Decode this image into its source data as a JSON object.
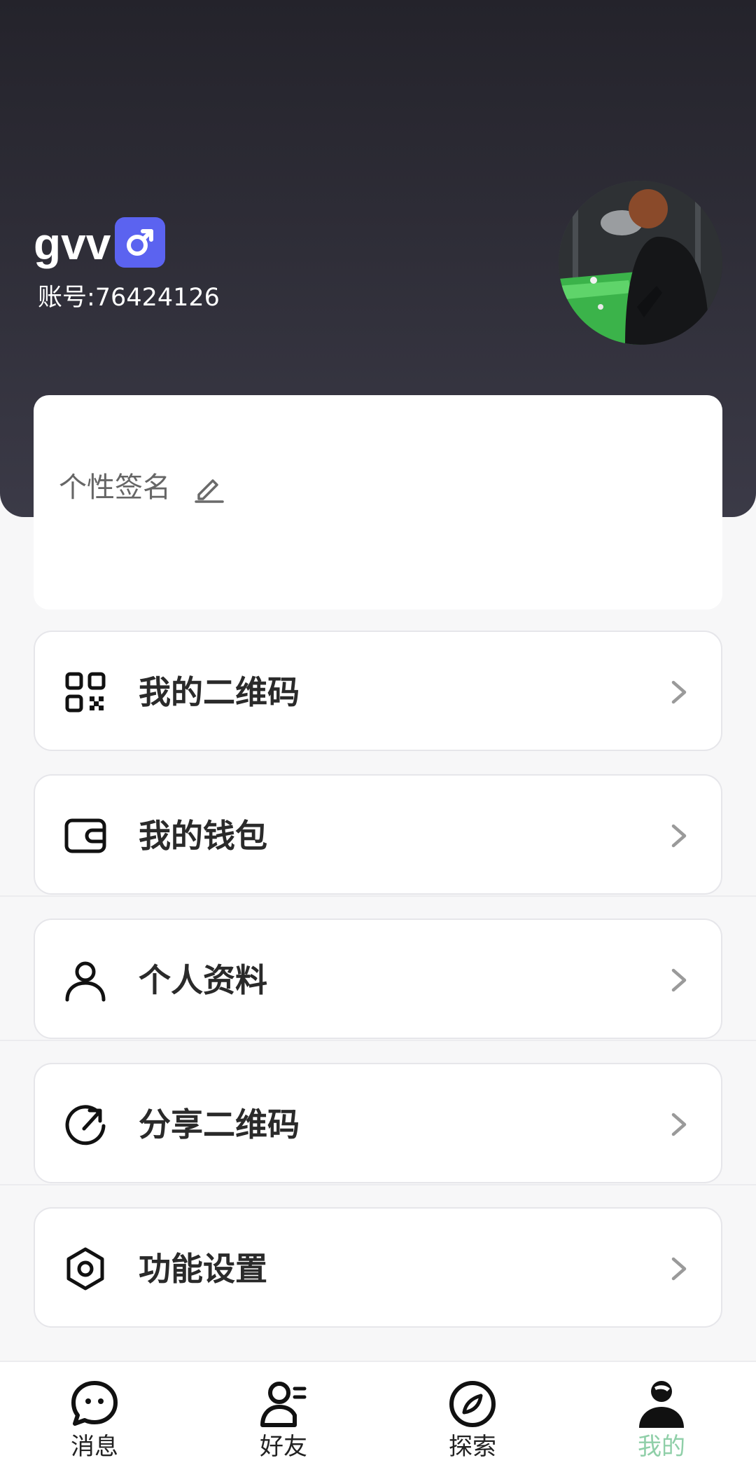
{
  "profile": {
    "username": "gvv",
    "gender_symbol": "♂",
    "account": "账号:76424126",
    "signature_label": "个性签名"
  },
  "menu": [
    {
      "label": "我的二维码",
      "icon": "qr-code-icon"
    },
    {
      "label": "我的钱包",
      "icon": "wallet-icon"
    },
    {
      "label": "个人资料",
      "icon": "user-icon"
    },
    {
      "label": "分享二维码",
      "icon": "share-icon"
    },
    {
      "label": "功能设置",
      "icon": "settings-icon"
    }
  ],
  "tabs": [
    {
      "label": "消息",
      "icon": "message-icon",
      "active": false
    },
    {
      "label": "好友",
      "icon": "friends-icon",
      "active": false
    },
    {
      "label": "探索",
      "icon": "compass-icon",
      "active": false
    },
    {
      "label": "我的",
      "icon": "profile-icon",
      "active": true
    }
  ],
  "colors": {
    "header_dark": "#24232b",
    "gender_badge": "#5b63f0",
    "active_tab": "#8fcfa8"
  }
}
